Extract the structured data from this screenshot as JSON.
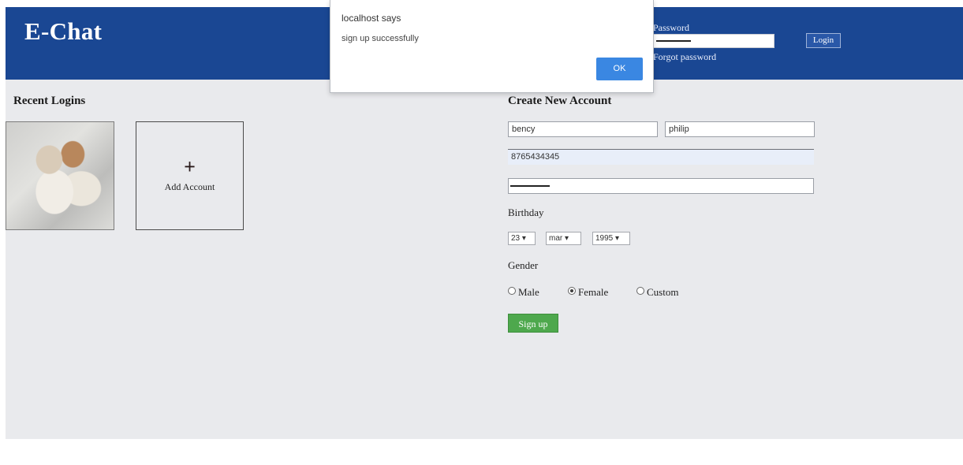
{
  "header": {
    "logo": "E-Chat",
    "password_label": "Password",
    "forgot_password": "Forgot password",
    "login_button": "Login"
  },
  "recent": {
    "title": "Recent Logins",
    "add_account": "Add Account",
    "add_symbol": "+"
  },
  "signup": {
    "title": "Create New Account",
    "first_name": "bency",
    "last_name": "philip",
    "phone": "8765434345",
    "birthday_label": "Birthday",
    "day": "23 ▾",
    "month": "mar ▾",
    "year": "1995 ▾",
    "gender_label": "Gender",
    "gender_male": "Male",
    "gender_female": "Female",
    "gender_custom": "Custom",
    "gender_selected": "Female",
    "submit": "Sign up"
  },
  "dialog": {
    "title": "localhost says",
    "message": "sign up successfully",
    "ok": "OK"
  },
  "colors": {
    "header_bg": "#1a4793",
    "signup_green": "#4ea84d",
    "ok_blue": "#3a87e2"
  }
}
